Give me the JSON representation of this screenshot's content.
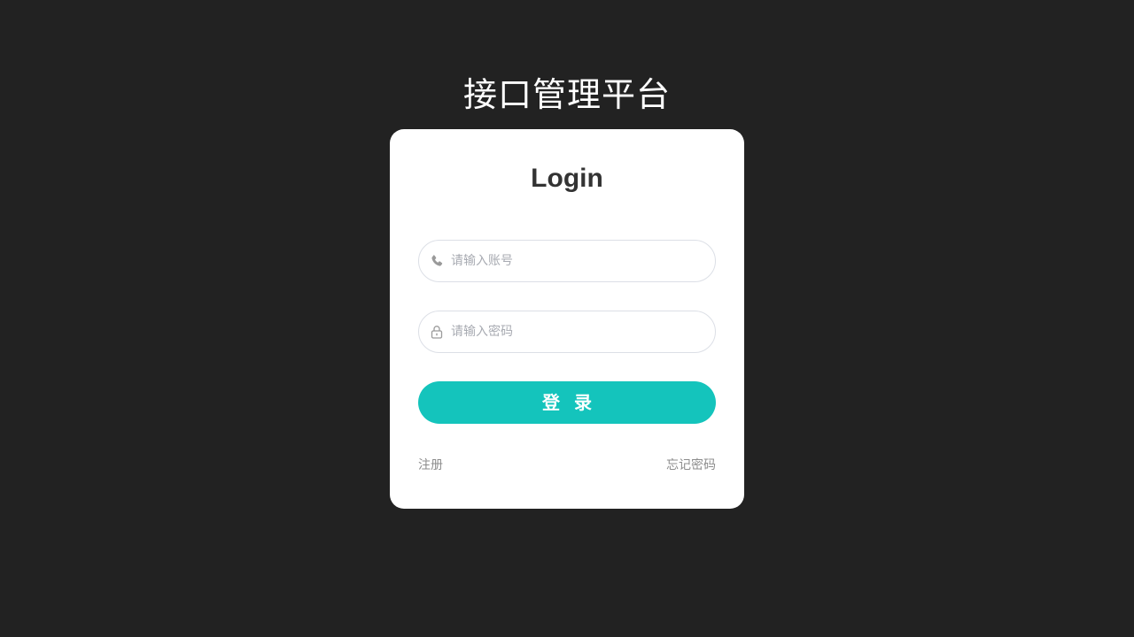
{
  "app": {
    "title": "接口管理平台"
  },
  "login_card": {
    "heading": "Login",
    "account_field": {
      "placeholder": "请输入账号",
      "value": "",
      "icon": "phone-icon"
    },
    "password_field": {
      "placeholder": "请输入密码",
      "value": "",
      "icon": "lock-icon"
    },
    "submit_label": "登录",
    "register_link": "注册",
    "forgot_link": "忘记密码"
  },
  "colors": {
    "background": "#222222",
    "card": "#ffffff",
    "accent": "#14c4bc",
    "muted_text": "#8c8c8c",
    "input_border": "#dcdfe6"
  }
}
